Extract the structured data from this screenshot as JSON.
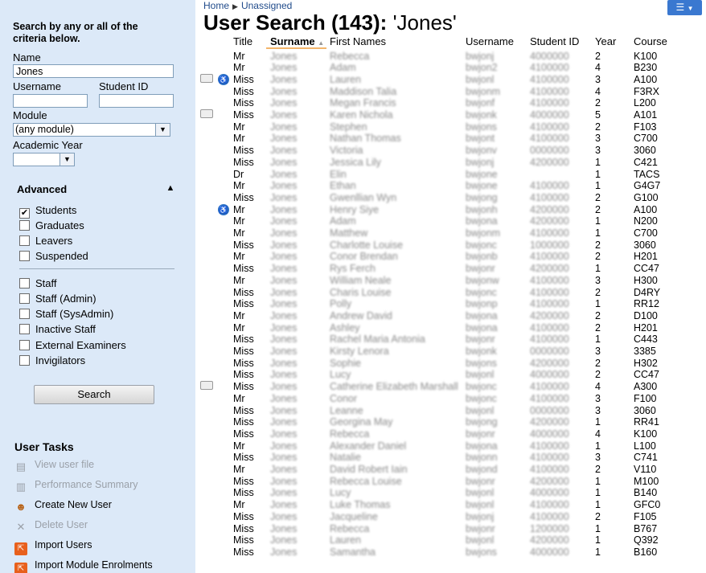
{
  "sidebar": {
    "intro": "Search by any or all of the criteria below.",
    "name_label": "Name",
    "name_value": "Jones",
    "username_label": "Username",
    "username_value": "",
    "studentid_label": "Student ID",
    "studentid_value": "",
    "module_label": "Module",
    "module_value": "(any module)",
    "year_label": "Academic Year",
    "year_value": "",
    "advanced_label": "Advanced",
    "options": [
      {
        "label": "Students",
        "checked": true
      },
      {
        "label": "Graduates",
        "checked": false
      },
      {
        "label": "Leavers",
        "checked": false
      },
      {
        "label": "Suspended",
        "checked": false
      },
      {
        "label": "Staff",
        "checked": false
      },
      {
        "label": "Staff (Admin)",
        "checked": false
      },
      {
        "label": "Staff (SysAdmin)",
        "checked": false
      },
      {
        "label": "Inactive Staff",
        "checked": false
      },
      {
        "label": "External Examiners",
        "checked": false
      },
      {
        "label": "Invigilators",
        "checked": false
      }
    ],
    "search_label": "Search",
    "tasks_title": "User Tasks",
    "tasks": [
      {
        "label": "View user file",
        "enabled": false,
        "icon": "user-file-icon"
      },
      {
        "label": "Performance Summary",
        "enabled": false,
        "icon": "chart-icon"
      },
      {
        "label": "Create New User",
        "enabled": true,
        "icon": "user-icon"
      },
      {
        "label": "Delete User",
        "enabled": false,
        "icon": "delete-icon"
      },
      {
        "label": "Import Users",
        "enabled": true,
        "icon": "import-icon"
      },
      {
        "label": "Import Module Enrolments",
        "enabled": true,
        "icon": "import-icon"
      }
    ]
  },
  "header": {
    "breadcrumb": [
      "Home",
      "Unassigned"
    ],
    "title_prefix": "User Search (143):",
    "title_query": "'Jones'"
  },
  "table": {
    "columns": [
      "Title",
      "Surname",
      "First Names",
      "Username",
      "Student ID",
      "Year",
      "Course"
    ],
    "rows": [
      {
        "title": "Mr",
        "surname": "Jones",
        "first": "Rebecca",
        "user": "bwjonj",
        "sid": "4000000",
        "year": "2",
        "course": "K100",
        "cam": false,
        "acc": false
      },
      {
        "title": "Mr",
        "surname": "Jones",
        "first": "Adam",
        "user": "bwjon2",
        "sid": "4100000",
        "year": "4",
        "course": "B230",
        "cam": false,
        "acc": false
      },
      {
        "title": "Miss",
        "surname": "Jones",
        "first": "Lauren",
        "user": "bwjonl",
        "sid": "4100000",
        "year": "3",
        "course": "A100",
        "cam": true,
        "acc": true
      },
      {
        "title": "Miss",
        "surname": "Jones",
        "first": "Maddison Talia",
        "user": "bwjonm",
        "sid": "4100000",
        "year": "4",
        "course": "F3RX",
        "cam": false,
        "acc": false
      },
      {
        "title": "Miss",
        "surname": "Jones",
        "first": "Megan Francis",
        "user": "bwjonf",
        "sid": "4100000",
        "year": "2",
        "course": "L200",
        "cam": false,
        "acc": false
      },
      {
        "title": "Miss",
        "surname": "Jones",
        "first": "Karen Nichola",
        "user": "bwjonk",
        "sid": "4000000",
        "year": "5",
        "course": "A101",
        "cam": true,
        "acc": false
      },
      {
        "title": "Mr",
        "surname": "Jones",
        "first": "Stephen",
        "user": "bwjons",
        "sid": "4100000",
        "year": "2",
        "course": "F103",
        "cam": false,
        "acc": false
      },
      {
        "title": "Mr",
        "surname": "Jones",
        "first": "Nathan Thomas",
        "user": "bwjont",
        "sid": "4100000",
        "year": "3",
        "course": "C700",
        "cam": false,
        "acc": false
      },
      {
        "title": "Miss",
        "surname": "Jones",
        "first": "Victoria",
        "user": "bwjonv",
        "sid": "0000000",
        "year": "3",
        "course": "3060",
        "cam": false,
        "acc": false
      },
      {
        "title": "Miss",
        "surname": "Jones",
        "first": "Jessica Lily",
        "user": "bwjonj",
        "sid": "4200000",
        "year": "1",
        "course": "C421",
        "cam": false,
        "acc": false
      },
      {
        "title": "Dr",
        "surname": "Jones",
        "first": "Elin",
        "user": "bwjone",
        "sid": "",
        "year": "1",
        "course": "TACS",
        "cam": false,
        "acc": false
      },
      {
        "title": "Mr",
        "surname": "Jones",
        "first": "Ethan",
        "user": "bwjone",
        "sid": "4100000",
        "year": "1",
        "course": "G4G7",
        "cam": false,
        "acc": false
      },
      {
        "title": "Miss",
        "surname": "Jones",
        "first": "Gwenllian Wyn",
        "user": "bwjong",
        "sid": "4100000",
        "year": "2",
        "course": "G100",
        "cam": false,
        "acc": false
      },
      {
        "title": "Mr",
        "surname": "Jones",
        "first": "Henry Siye",
        "user": "bwjonh",
        "sid": "4200000",
        "year": "2",
        "course": "A100",
        "cam": false,
        "acc": true
      },
      {
        "title": "Mr",
        "surname": "Jones",
        "first": "Adam",
        "user": "bwjona",
        "sid": "4200000",
        "year": "1",
        "course": "N200",
        "cam": false,
        "acc": false
      },
      {
        "title": "Mr",
        "surname": "Jones",
        "first": "Matthew",
        "user": "bwjonm",
        "sid": "4100000",
        "year": "1",
        "course": "C700",
        "cam": false,
        "acc": false
      },
      {
        "title": "Miss",
        "surname": "Jones",
        "first": "Charlotte Louise",
        "user": "bwjonc",
        "sid": "1000000",
        "year": "2",
        "course": "3060",
        "cam": false,
        "acc": false
      },
      {
        "title": "Mr",
        "surname": "Jones",
        "first": "Conor Brendan",
        "user": "bwjonb",
        "sid": "4100000",
        "year": "2",
        "course": "H201",
        "cam": false,
        "acc": false
      },
      {
        "title": "Miss",
        "surname": "Jones",
        "first": "Rys Ferch",
        "user": "bwjonr",
        "sid": "4200000",
        "year": "1",
        "course": "CC47",
        "cam": false,
        "acc": false
      },
      {
        "title": "Mr",
        "surname": "Jones",
        "first": "William Neale",
        "user": "bwjonw",
        "sid": "4100000",
        "year": "3",
        "course": "H300",
        "cam": false,
        "acc": false
      },
      {
        "title": "Miss",
        "surname": "Jones",
        "first": "Charis Louise",
        "user": "bwjonc",
        "sid": "4100000",
        "year": "2",
        "course": "D4RY",
        "cam": false,
        "acc": false
      },
      {
        "title": "Miss",
        "surname": "Jones",
        "first": "Polly",
        "user": "bwjonp",
        "sid": "4100000",
        "year": "1",
        "course": "RR12",
        "cam": false,
        "acc": false
      },
      {
        "title": "Mr",
        "surname": "Jones",
        "first": "Andrew David",
        "user": "bwjona",
        "sid": "4200000",
        "year": "2",
        "course": "D100",
        "cam": false,
        "acc": false
      },
      {
        "title": "Mr",
        "surname": "Jones",
        "first": "Ashley",
        "user": "bwjona",
        "sid": "4100000",
        "year": "2",
        "course": "H201",
        "cam": false,
        "acc": false
      },
      {
        "title": "Miss",
        "surname": "Jones",
        "first": "Rachel Maria Antonia",
        "user": "bwjonr",
        "sid": "4100000",
        "year": "1",
        "course": "C443",
        "cam": false,
        "acc": false
      },
      {
        "title": "Miss",
        "surname": "Jones",
        "first": "Kirsty Lenora",
        "user": "bwjonk",
        "sid": "0000000",
        "year": "3",
        "course": "3385",
        "cam": false,
        "acc": false
      },
      {
        "title": "Miss",
        "surname": "Jones",
        "first": "Sophie",
        "user": "bwjons",
        "sid": "4200000",
        "year": "2",
        "course": "H302",
        "cam": false,
        "acc": false
      },
      {
        "title": "Miss",
        "surname": "Jones",
        "first": "Lucy",
        "user": "bwjonl",
        "sid": "4000000",
        "year": "2",
        "course": "CC47",
        "cam": false,
        "acc": false
      },
      {
        "title": "Miss",
        "surname": "Jones",
        "first": "Catherine Elizabeth Marshall",
        "user": "bwjonc",
        "sid": "4100000",
        "year": "4",
        "course": "A300",
        "cam": true,
        "acc": false
      },
      {
        "title": "Mr",
        "surname": "Jones",
        "first": "Conor",
        "user": "bwjonc",
        "sid": "4100000",
        "year": "3",
        "course": "F100",
        "cam": false,
        "acc": false
      },
      {
        "title": "Miss",
        "surname": "Jones",
        "first": "Leanne",
        "user": "bwjonl",
        "sid": "0000000",
        "year": "3",
        "course": "3060",
        "cam": false,
        "acc": false
      },
      {
        "title": "Miss",
        "surname": "Jones",
        "first": "Georgina May",
        "user": "bwjong",
        "sid": "4200000",
        "year": "1",
        "course": "RR41",
        "cam": false,
        "acc": false
      },
      {
        "title": "Miss",
        "surname": "Jones",
        "first": "Rebecca",
        "user": "bwjonr",
        "sid": "4000000",
        "year": "4",
        "course": "K100",
        "cam": false,
        "acc": false
      },
      {
        "title": "Mr",
        "surname": "Jones",
        "first": "Alexander Daniel",
        "user": "bwjona",
        "sid": "4100000",
        "year": "1",
        "course": "L100",
        "cam": false,
        "acc": false
      },
      {
        "title": "Miss",
        "surname": "Jones",
        "first": "Natalie",
        "user": "bwjonn",
        "sid": "4100000",
        "year": "3",
        "course": "C741",
        "cam": false,
        "acc": false
      },
      {
        "title": "Mr",
        "surname": "Jones",
        "first": "David Robert Iain",
        "user": "bwjond",
        "sid": "4100000",
        "year": "2",
        "course": "V110",
        "cam": false,
        "acc": false
      },
      {
        "title": "Miss",
        "surname": "Jones",
        "first": "Rebecca Louise",
        "user": "bwjonr",
        "sid": "4200000",
        "year": "1",
        "course": "M100",
        "cam": false,
        "acc": false
      },
      {
        "title": "Miss",
        "surname": "Jones",
        "first": "Lucy",
        "user": "bwjonl",
        "sid": "4000000",
        "year": "1",
        "course": "B140",
        "cam": false,
        "acc": false
      },
      {
        "title": "Mr",
        "surname": "Jones",
        "first": "Luke Thomas",
        "user": "bwjonl",
        "sid": "4100000",
        "year": "1",
        "course": "GFC0",
        "cam": false,
        "acc": false
      },
      {
        "title": "Miss",
        "surname": "Jones",
        "first": "Jacqueline",
        "user": "bwjonj",
        "sid": "4100000",
        "year": "2",
        "course": "F105",
        "cam": false,
        "acc": false
      },
      {
        "title": "Miss",
        "surname": "Jones",
        "first": "Rebecca",
        "user": "bwjonr",
        "sid": "1200000",
        "year": "1",
        "course": "B767",
        "cam": false,
        "acc": false
      },
      {
        "title": "Miss",
        "surname": "Jones",
        "first": "Lauren",
        "user": "bwjonl",
        "sid": "4200000",
        "year": "1",
        "course": "Q392",
        "cam": false,
        "acc": false
      },
      {
        "title": "Miss",
        "surname": "Jones",
        "first": "Samantha",
        "user": "bwjons",
        "sid": "4000000",
        "year": "1",
        "course": "B160",
        "cam": false,
        "acc": false
      }
    ]
  }
}
